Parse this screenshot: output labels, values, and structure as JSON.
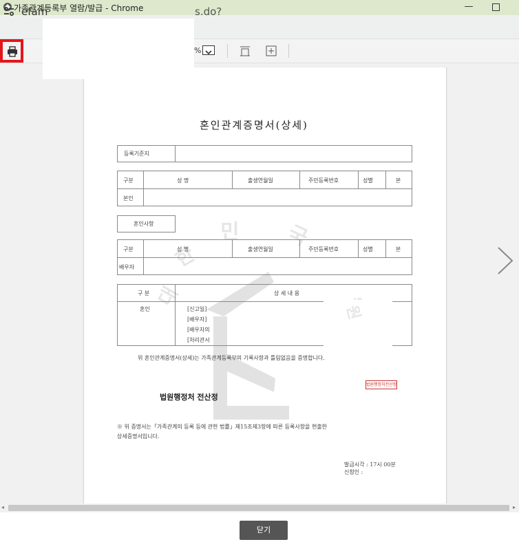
{
  "window": {
    "title": "가족관계등록부 열람/발급 - Chrome",
    "minimize": "—"
  },
  "address_bar": {
    "url_start": "efam",
    "url_end": "s.do?"
  },
  "toolbar": {
    "zoom_suffix": "%"
  },
  "document": {
    "title": "혼인관계증명서(상세)",
    "registry_label": "등록기준지",
    "headers": {
      "category": "구분",
      "name": "성 명",
      "birth": "출생연월일",
      "resident_no": "주민등록번호",
      "sex": "성별",
      "origin": "본"
    },
    "self_label": "본인",
    "marriage_section_label": "혼인사항",
    "spouse_label": "배우자",
    "detail_header_category": "구 분",
    "detail_header_content": "상 세 내 용",
    "marriage_label": "혼인",
    "detail_lines": [
      "[신고일]",
      "[배우자]",
      "[배우자의",
      "[처리관서"
    ],
    "certify_text": "위 혼인관계증명서(상세)는 가족관계등록부의 기록사항과 틀림없음을 증명합니다.",
    "authority_name": "법원행정처 전산정",
    "seal_text": "법원행정처전산정보",
    "note_text_line1": "※ 위 증명서는「가족관계의 등록 등에 관한 법률」제15조제3항에 따른 등록사항을 현출한",
    "note_text_line2": "상세증명서입니다.",
    "issue_time": "발급시각 : 17시 00분",
    "applicant": "신청인 :",
    "watermark": [
      "민",
      "국",
      "한",
      "대",
      "법",
      "원"
    ]
  },
  "footer": {
    "close_label": "닫기"
  },
  "colors": {
    "titlebar_bg": "#dde8cc",
    "highlight_red": "#e4151b",
    "close_button_bg": "#555555"
  }
}
